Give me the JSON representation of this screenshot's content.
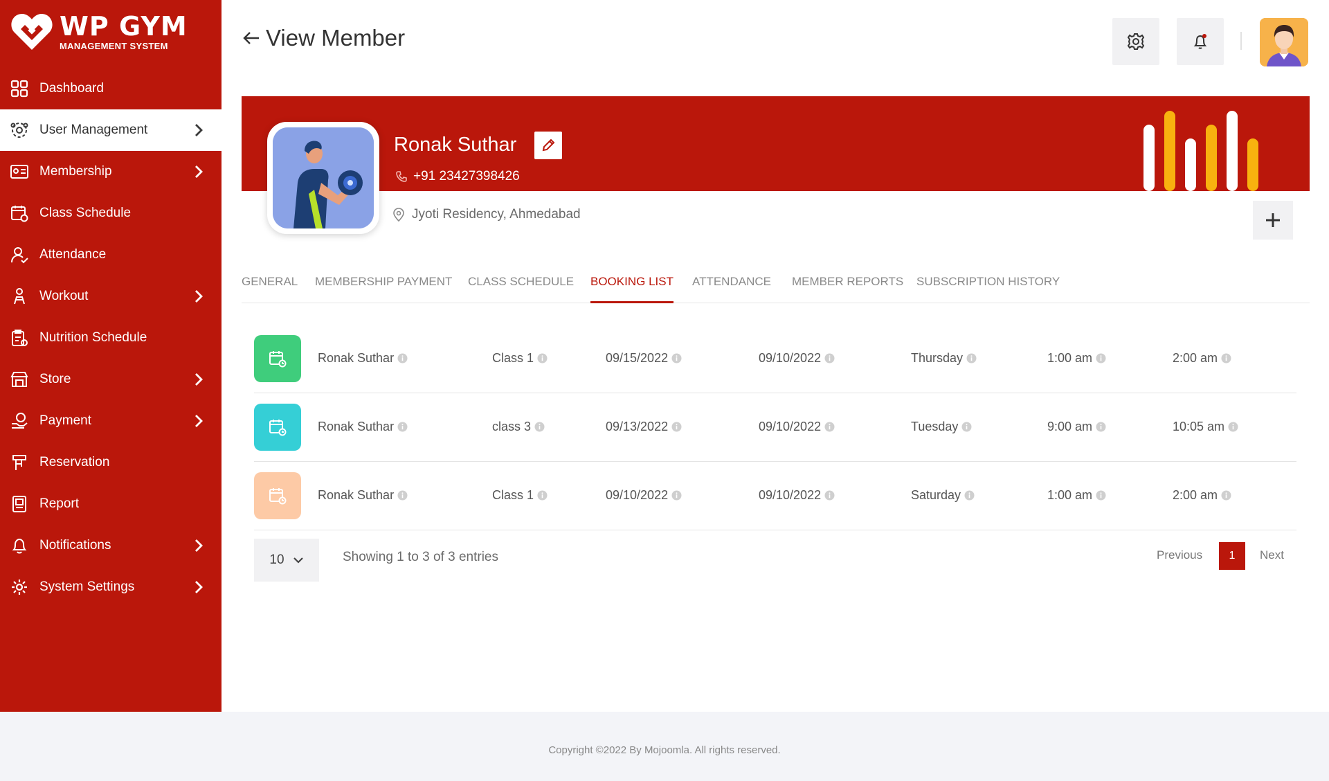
{
  "brand": {
    "title": "WP GYM",
    "subtitle": "MANAGEMENT SYSTEM",
    "color": "#ba170b"
  },
  "sidebar": {
    "items": [
      {
        "label": "Dashboard",
        "icon": "dashboard-icon",
        "has_submenu": false,
        "active": false
      },
      {
        "label": "User Management",
        "icon": "users-gear-icon",
        "has_submenu": true,
        "active": true
      },
      {
        "label": "Membership",
        "icon": "membership-card-icon",
        "has_submenu": true,
        "active": false
      },
      {
        "label": "Class Schedule",
        "icon": "calendar-icon",
        "has_submenu": false,
        "active": false
      },
      {
        "label": "Attendance",
        "icon": "attendance-icon",
        "has_submenu": false,
        "active": false
      },
      {
        "label": "Workout",
        "icon": "workout-icon",
        "has_submenu": true,
        "active": false
      },
      {
        "label": "Nutrition Schedule",
        "icon": "nutrition-icon",
        "has_submenu": false,
        "active": false
      },
      {
        "label": "Store",
        "icon": "store-icon",
        "has_submenu": true,
        "active": false
      },
      {
        "label": "Payment",
        "icon": "payment-icon",
        "has_submenu": true,
        "active": false
      },
      {
        "label": "Reservation",
        "icon": "reservation-icon",
        "has_submenu": false,
        "active": false
      },
      {
        "label": "Report",
        "icon": "report-icon",
        "has_submenu": false,
        "active": false
      },
      {
        "label": "Notifications",
        "icon": "bell-icon",
        "has_submenu": true,
        "active": false
      },
      {
        "label": "System Settings",
        "icon": "gear-icon",
        "has_submenu": true,
        "active": false
      }
    ]
  },
  "header": {
    "title": "View Member"
  },
  "member": {
    "name": "Ronak Suthar",
    "phone": "+91  23427398426",
    "address": "Jyoti Residency, Ahmedabad"
  },
  "tabs": [
    {
      "label": "GENERAL",
      "active": false
    },
    {
      "label": "MEMBERSHIP PAYMENT",
      "active": false
    },
    {
      "label": "CLASS SCHEDULE",
      "active": false
    },
    {
      "label": "BOOKING LIST",
      "active": true
    },
    {
      "label": "ATTENDANCE",
      "active": false
    },
    {
      "label": "MEMBER REPORTS",
      "active": false
    },
    {
      "label": "SUBSCRIPTION HISTORY",
      "active": false
    }
  ],
  "bookings": [
    {
      "icon_color": "#3fcd7c",
      "member": "Ronak Suthar",
      "class": "Class 1",
      "class_date": "09/15/2022",
      "booking_date": "09/10/2022",
      "day": "Thursday",
      "start": "1:00 am",
      "end": "2:00 am"
    },
    {
      "icon_color": "#35cfd6",
      "member": "Ronak Suthar",
      "class": "class 3",
      "class_date": "09/13/2022",
      "booking_date": "09/10/2022",
      "day": "Tuesday",
      "start": "9:00 am",
      "end": "10:05 am"
    },
    {
      "icon_color": "#fdcaa6",
      "member": "Ronak Suthar",
      "class": "Class 1",
      "class_date": "09/10/2022",
      "booking_date": "09/10/2022",
      "day": "Saturday",
      "start": "1:00 am",
      "end": "2:00 am"
    }
  ],
  "pagination": {
    "page_size": "10",
    "showing": "Showing 1 to 3 of 3 entries",
    "previous": "Previous",
    "current": "1",
    "next": "Next"
  },
  "footer": {
    "copyright": "Copyright ©2022 By Mojoomla. All rights reserved."
  }
}
